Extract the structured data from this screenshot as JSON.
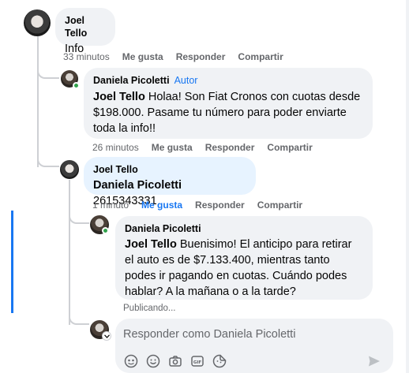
{
  "comments": [
    {
      "author": "Joel Tello",
      "text": "Info",
      "time": "33 minutos",
      "like": "Me gusta",
      "reply": "Responder",
      "share": "Compartir"
    },
    {
      "author": "Daniela Picoletti",
      "author_tag": "Autor",
      "mention": "Joel Tello",
      "text_line1": " Holaa! Son Fiat Cronos con cuotas desde",
      "text_line2": "$198.000. Pasame tu número para poder enviarte",
      "text_line3": "toda la info!!",
      "time": "26 minutos",
      "like": "Me gusta",
      "reply": "Responder",
      "share": "Compartir"
    },
    {
      "author": "Joel Tello",
      "mention": "Daniela Picoletti",
      "text": " 2615343331",
      "time": "1 minuto",
      "like": "Me gusta",
      "reply": "Responder",
      "share": "Compartir"
    },
    {
      "author": "Daniela Picoletti",
      "mention": "Joel Tello",
      "text_line1": " Buenisimo! El anticipo para retirar",
      "text_line2": "el auto es de $7.133.400, mientras tanto",
      "text_line3": "podes ir pagando en cuotas. Cuándo podes",
      "text_line4": "hablar? A la mañana o a la tarde?",
      "status": "Publicando..."
    }
  ],
  "composer": {
    "placeholder": "Responder como Daniela Picoletti"
  },
  "toolbar_icons": [
    "avatar-sticker-icon",
    "emoji-icon",
    "camera-icon",
    "gif-icon",
    "sticker-icon"
  ],
  "colors": {
    "accent": "#1877f2",
    "bubble": "#f0f2f5",
    "highlight_bubble": "#e7f3ff",
    "online": "#31a24c"
  }
}
